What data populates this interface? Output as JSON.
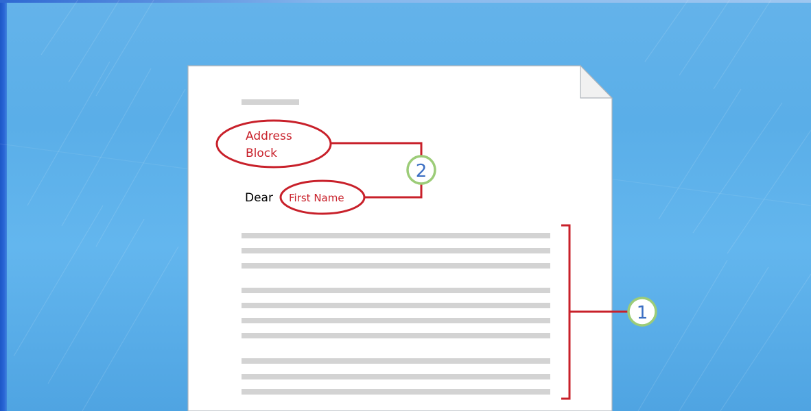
{
  "document": {
    "address_block": [
      "Address",
      "Block"
    ],
    "salutation": "Dear",
    "first_name_field": "First Name"
  },
  "callouts": [
    {
      "number": "1"
    },
    {
      "number": "2"
    }
  ],
  "colors": {
    "background": "#5aaee8",
    "field_red": "#c8202a",
    "callout_ring_green": "#9ccc78",
    "callout_number_blue": "#3c6fc3",
    "body_line_gray": "#d3d3d3",
    "page": "#ffffff"
  }
}
